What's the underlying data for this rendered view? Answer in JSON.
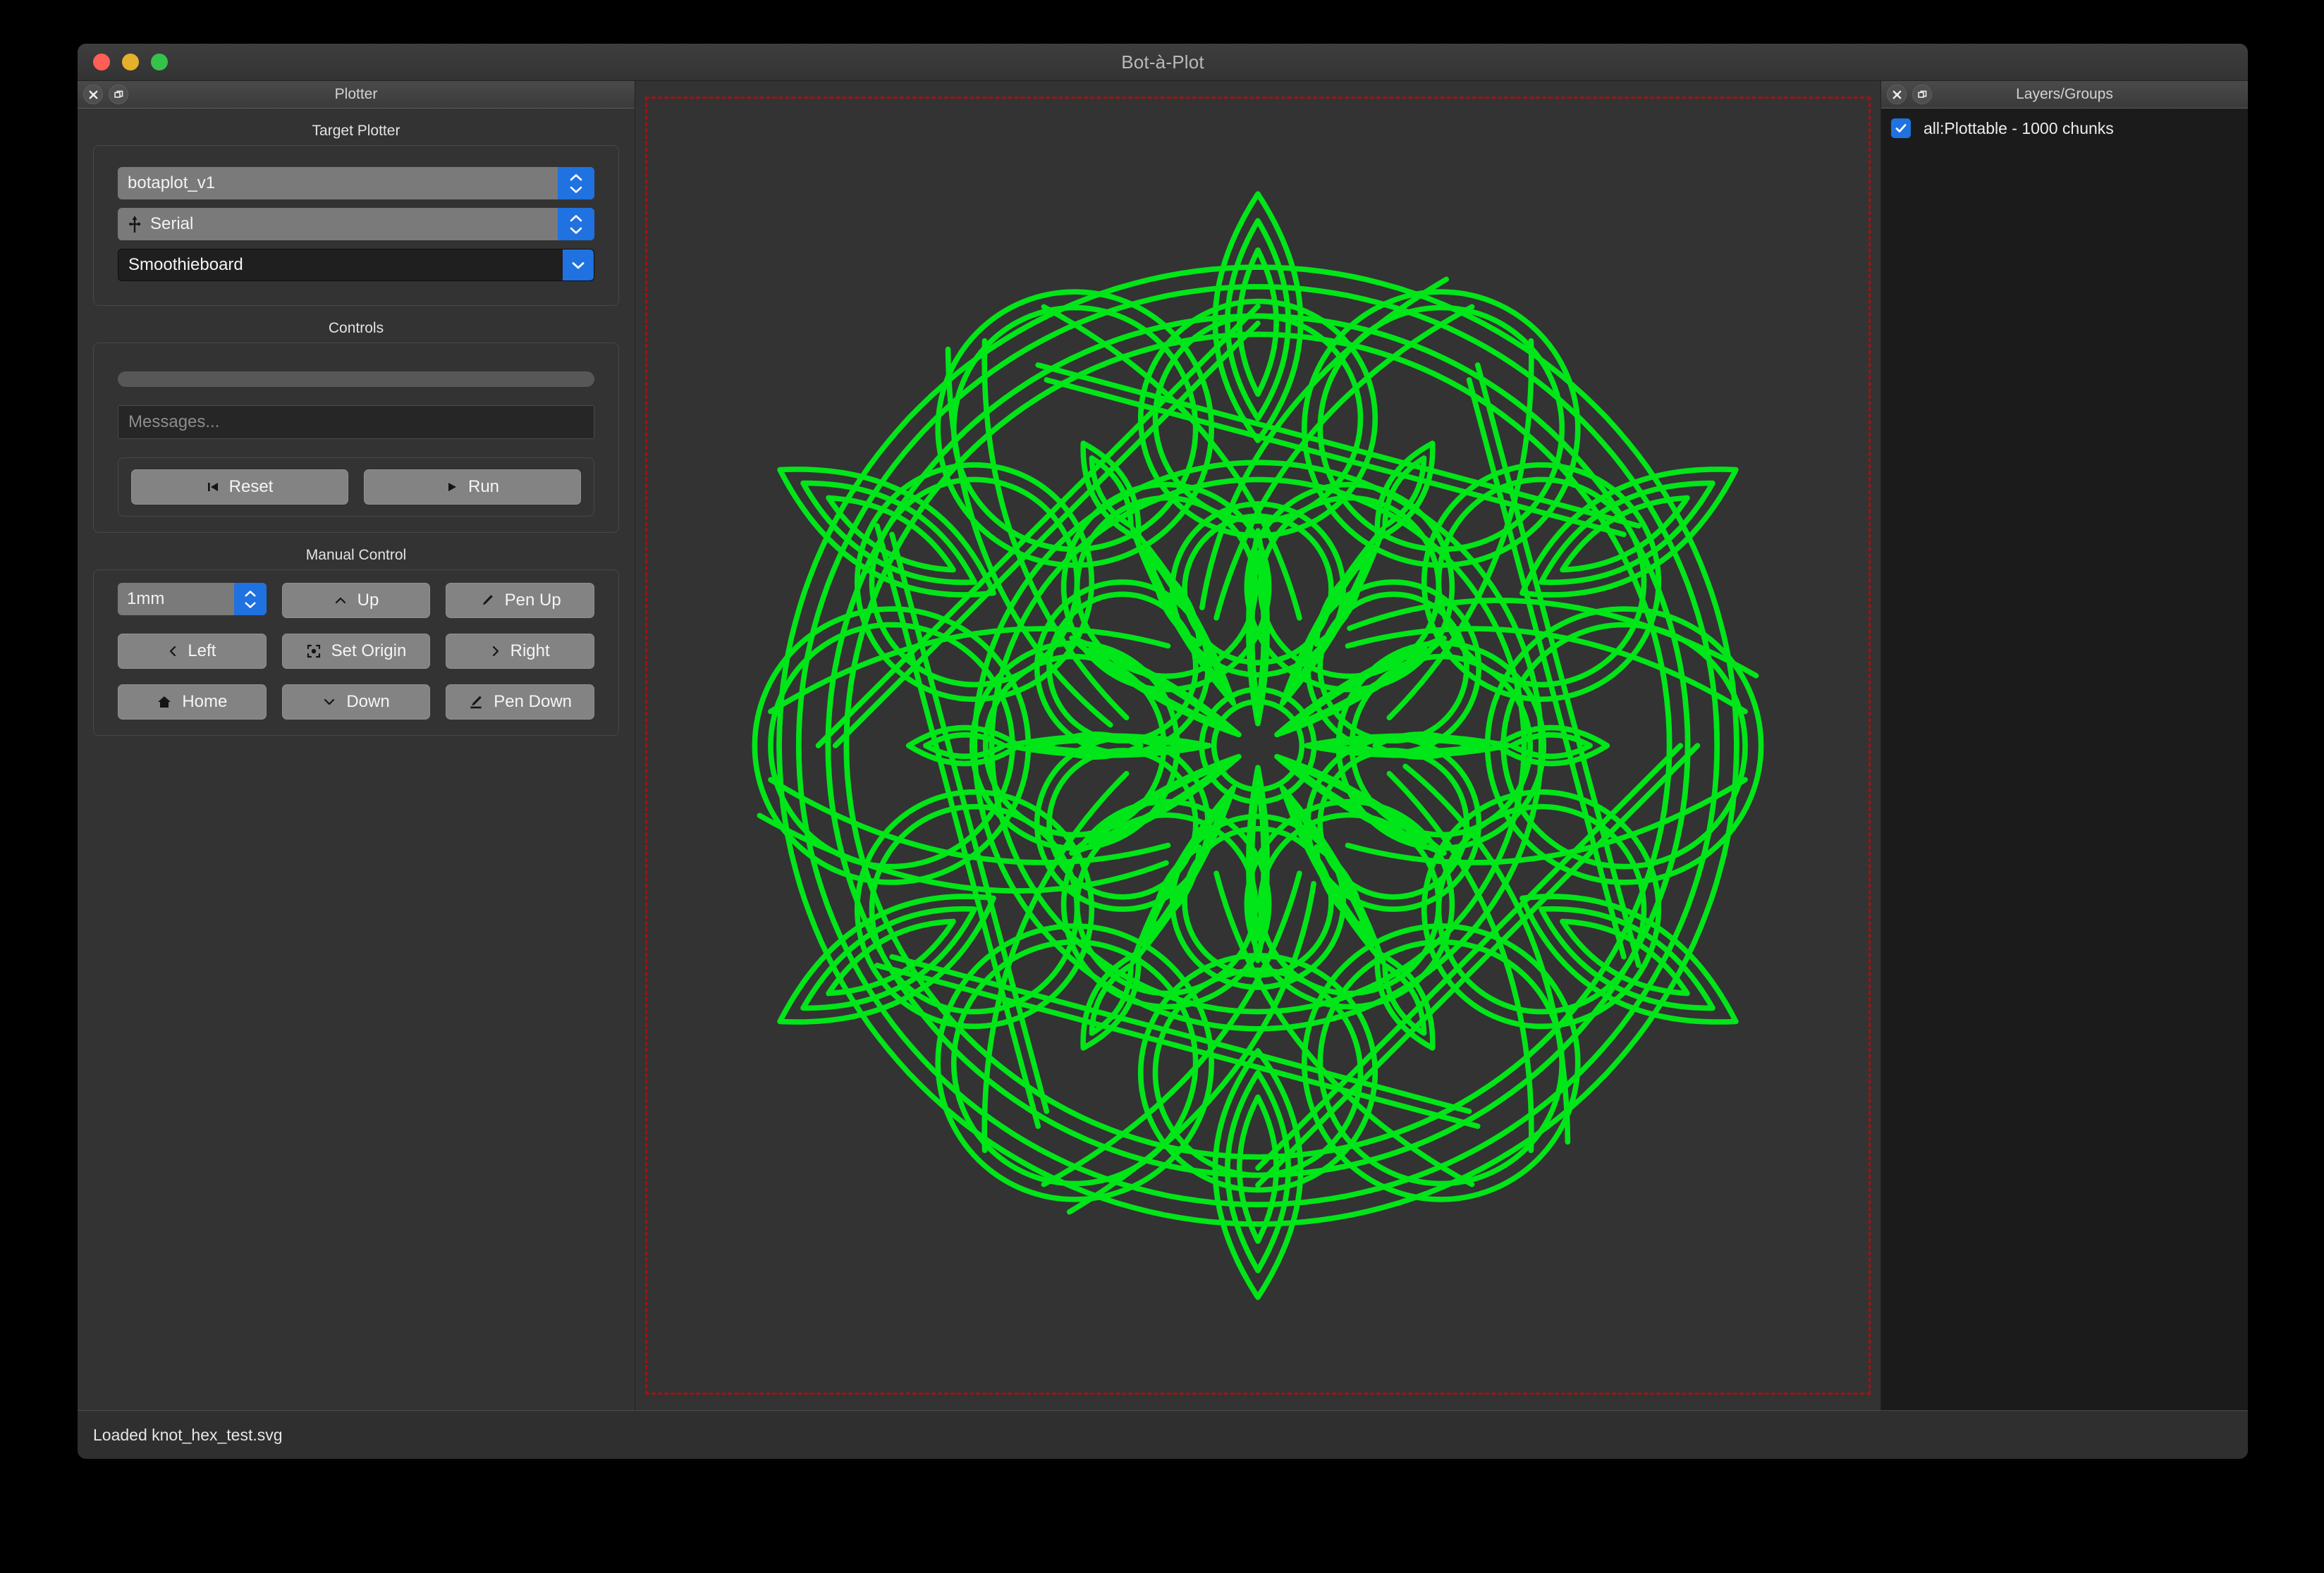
{
  "window": {
    "title": "Bot-à-Plot",
    "traffic_lights": [
      "close",
      "minimize",
      "zoom"
    ],
    "colors": {
      "close": "#ff5f57",
      "minimize": "#e5b02a",
      "zoom": "#34c24a",
      "accent_blue": "#1f72e0",
      "plot_stroke": "#00e619",
      "plot_border": "#a11212",
      "canvas_bg": "#333333"
    }
  },
  "left_panel": {
    "title": "Plotter",
    "titlebar_buttons": [
      {
        "name": "close-icon",
        "label": "Close"
      },
      {
        "name": "float-icon",
        "label": "Float"
      }
    ],
    "target_plotter": {
      "label": "Target Plotter",
      "plotter_select": {
        "value": "botaplot_v1",
        "icon": "none"
      },
      "connection_select": {
        "value": "Serial",
        "icon": "usb-icon"
      },
      "firmware_combo": {
        "value": "Smoothieboard",
        "editable": true
      }
    },
    "controls": {
      "label": "Controls",
      "progress_value": 0,
      "message_input": {
        "value": "",
        "placeholder": "Messages..."
      },
      "buttons": [
        {
          "name": "reset-button",
          "label": "Reset",
          "glyph": "skip-back-icon"
        },
        {
          "name": "run-button",
          "label": "Run",
          "glyph": "play-icon"
        }
      ]
    },
    "manual_control": {
      "label": "Manual Control",
      "step_select": {
        "value": "1mm"
      },
      "buttons": [
        {
          "name": "up-button",
          "label": "Up",
          "glyph": "chevron-up-icon"
        },
        {
          "name": "pen-up-button",
          "label": "Pen Up",
          "glyph": "pen-up-icon"
        },
        {
          "name": "left-button",
          "label": "Left",
          "glyph": "chevron-left-icon"
        },
        {
          "name": "set-origin-button",
          "label": "Set Origin",
          "glyph": "crosshair-icon"
        },
        {
          "name": "right-button",
          "label": "Right",
          "glyph": "chevron-right-icon"
        },
        {
          "name": "home-button",
          "label": "Home",
          "glyph": "home-icon"
        },
        {
          "name": "down-button",
          "label": "Down",
          "glyph": "chevron-down-icon"
        },
        {
          "name": "pen-down-button",
          "label": "Pen Down",
          "glyph": "pen-down-icon"
        }
      ]
    }
  },
  "right_panel": {
    "title": "Layers/Groups",
    "titlebar_buttons": [
      {
        "name": "close-icon",
        "label": "Close"
      },
      {
        "name": "float-icon",
        "label": "Float"
      }
    ],
    "layers": [
      {
        "name": "all:Plottable - 1000 chunks",
        "checked": true
      }
    ]
  },
  "canvas": {
    "artwork": "celtic hexagonal knot",
    "border_style": "dashed"
  },
  "status_bar": {
    "text": "Loaded knot_hex_test.svg"
  }
}
